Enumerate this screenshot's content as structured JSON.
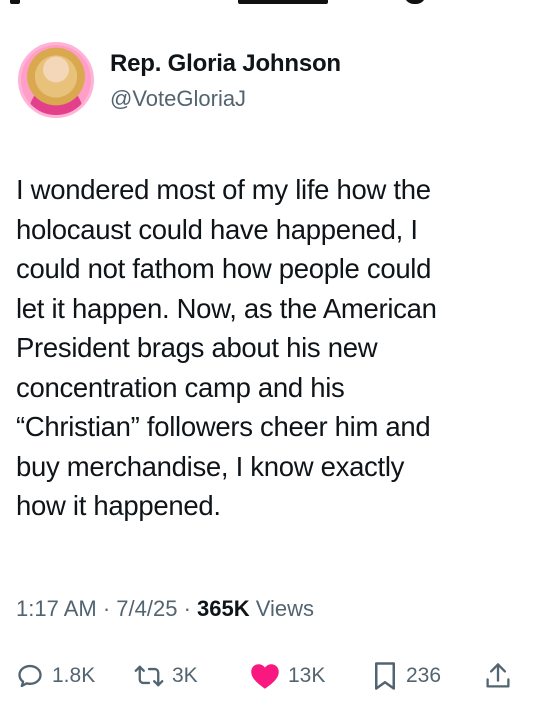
{
  "author": {
    "name": "Rep. Gloria Johnson",
    "handle": "@VoteGloriaJ"
  },
  "post": {
    "text": "I wondered most of my life how the\nholocaust could have happened, I\ncould not fathom how people could\nlet it happen. Now, as the American\nPresident brags about his new\nconcentration camp and his\n“Christian” followers cheer him and\nbuy merchandise, I know exactly\nhow it happened.",
    "time": "1:17 AM",
    "date": "7/4/25",
    "separator": "·",
    "views_count": "365K",
    "views_label": "Views"
  },
  "actions": {
    "replies": "1.8K",
    "reposts": "3K",
    "likes": "13K",
    "bookmarks": "236"
  },
  "icons": {
    "reply": "reply-bubble-icon",
    "repost": "repost-arrows-icon",
    "like": "heart-icon",
    "bookmark": "bookmark-icon",
    "share": "share-upload-icon"
  },
  "colors": {
    "like_active": "#f91880",
    "secondary_text": "#536471",
    "primary_text": "#0f1419"
  }
}
